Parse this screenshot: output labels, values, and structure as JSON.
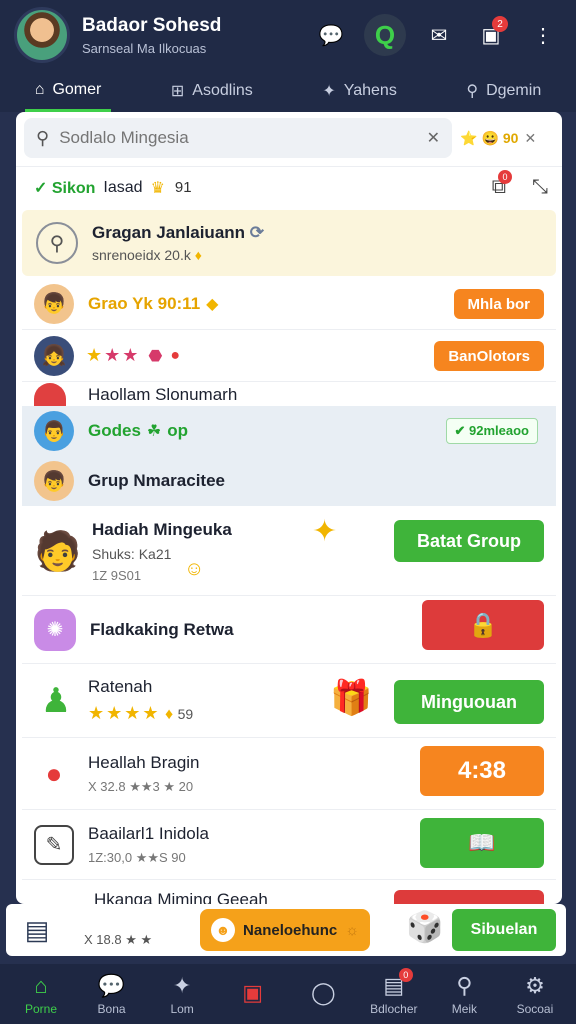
{
  "header": {
    "user_name": "Badaor Sohesd",
    "user_sub": "Sarnseal Ma Ilkocuas",
    "notif_count": "2"
  },
  "tabs": [
    {
      "label": "Gomer",
      "icon": "home-icon"
    },
    {
      "label": "Asodlins",
      "icon": "grid-icon"
    },
    {
      "label": "Yahens",
      "icon": "star-icon"
    },
    {
      "label": "Dgemin",
      "icon": "search-icon"
    }
  ],
  "search": {
    "placeholder": "Sodlalo Mingesia",
    "coins": "90"
  },
  "status": {
    "online": "Sikon",
    "text": "Iasad",
    "count": "91",
    "notif": "0"
  },
  "featured": {
    "title": "Gragan Janlaiuann",
    "sub": "snrenoeidx 20.k"
  },
  "rows": {
    "r1": {
      "label": "Grao Yk 90:11",
      "button": "Mhla bor"
    },
    "r2": {
      "button": "BanOlotors"
    },
    "r3": {
      "title": "Haollam Slonumarh"
    },
    "r4": {
      "label": "Godes",
      "suffix": "op",
      "check": "✔ 92mleaoo"
    },
    "r5": {
      "title": "Grup Nmaracitee"
    },
    "r6": {
      "title": "Hadiah Mingeuka",
      "sub": "Shuks: Ka21",
      "meta": "1Z 9S01",
      "button": "Batat Group"
    },
    "r7": {
      "title": "Fladkaking Retwa"
    },
    "r8": {
      "title": "Ratenah",
      "count": "59",
      "button": "Minguouan"
    },
    "r9": {
      "title": "Heallah Bragin",
      "meta": "X 32.8  ★★3  ★ 20",
      "button": "4:38"
    },
    "r10": {
      "title": "Baailarl1 Inidola",
      "meta": "1Z:30,0  ★★S  90"
    },
    "r11": {
      "title": "Hkanga Miming Geeah",
      "meta": "X 18.8  ★ ★"
    }
  },
  "actionbar": {
    "main_label": "Naneloehunc",
    "right_label": "Sibuelan"
  },
  "bottomnav": [
    {
      "label": "Porne",
      "icon": "home-icon"
    },
    {
      "label": "Bona",
      "icon": "chat-icon"
    },
    {
      "label": "Lom",
      "icon": "wand-icon"
    },
    {
      "label": "",
      "icon": "gamepad-icon"
    },
    {
      "label": "",
      "icon": "ring-icon"
    },
    {
      "label": "Bdlocher",
      "icon": "bag-icon",
      "badge": "0"
    },
    {
      "label": "Meik",
      "icon": "search-icon"
    },
    {
      "label": "Socoai",
      "icon": "gear-icon"
    }
  ],
  "colors": {
    "accent_green": "#3ecf4a",
    "orange": "#f6851f",
    "red": "#dd3b3b",
    "header_bg": "#202a46"
  }
}
